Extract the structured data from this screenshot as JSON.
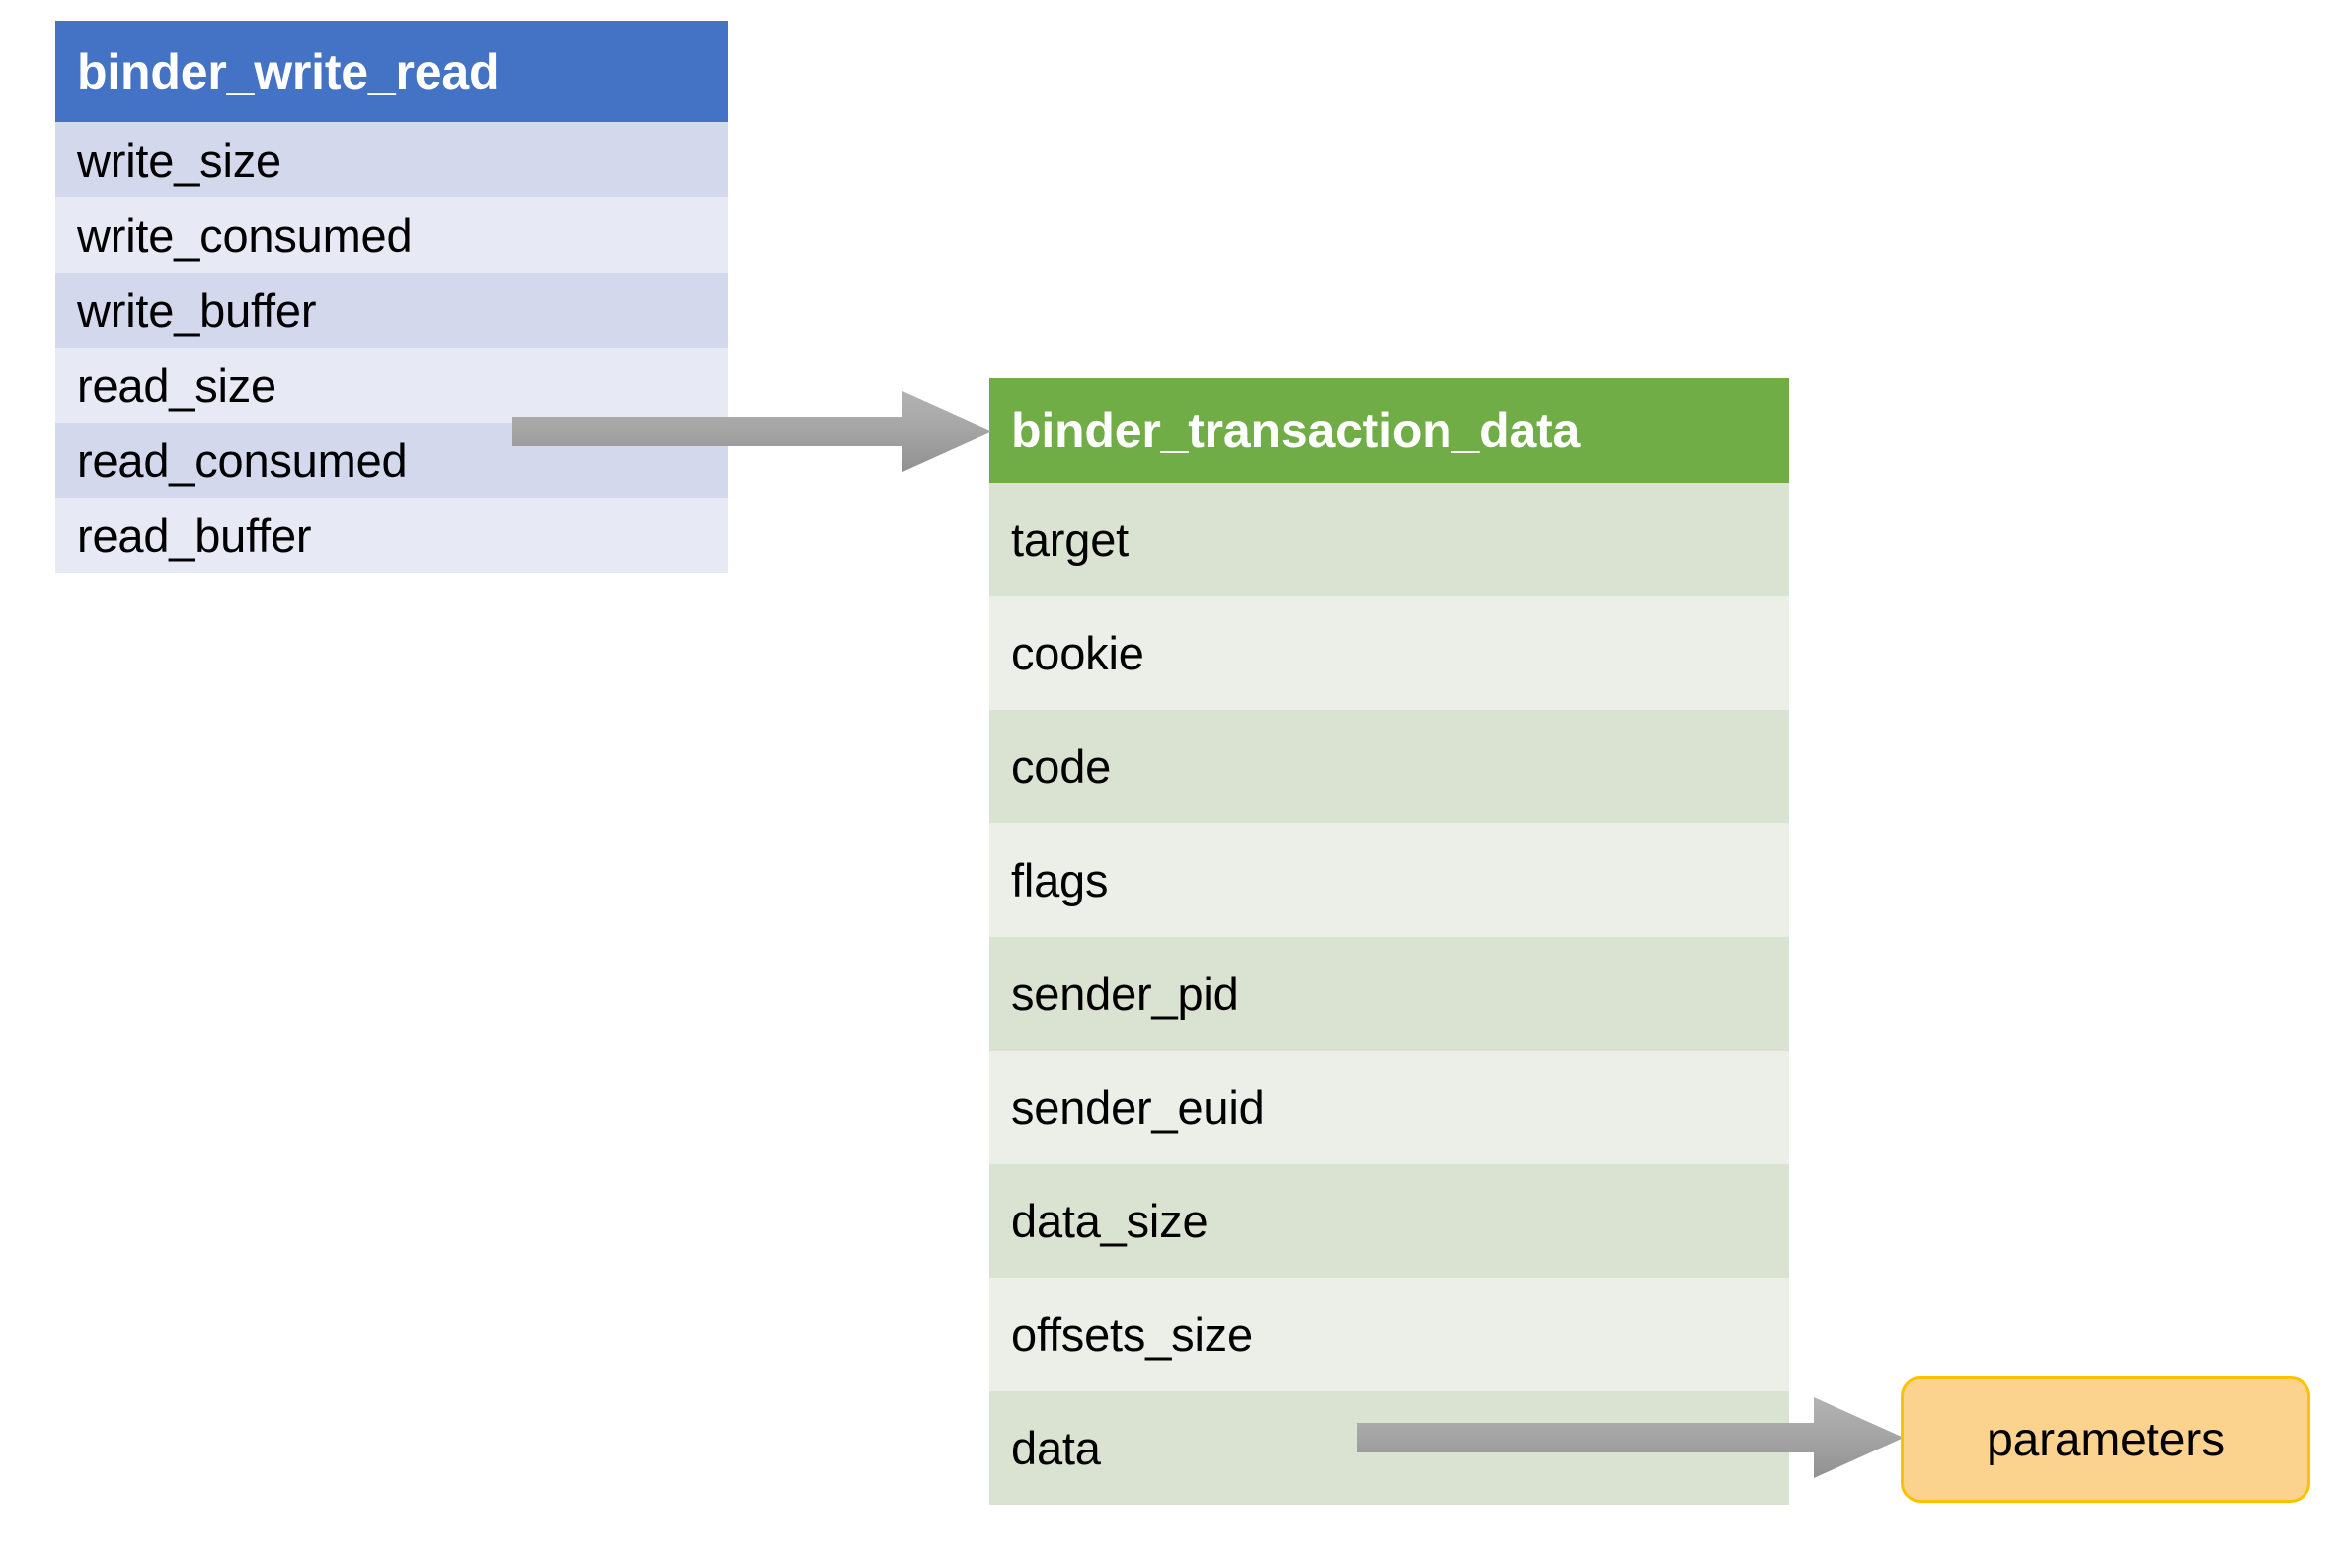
{
  "diagram": {
    "title_struct_left": "binder_write_read",
    "title_struct_right": "binder_transaction_data",
    "colors": {
      "left_header": "#4472C4",
      "left_row_odd": "#D3D8EC",
      "left_row_even": "#E7EAF5",
      "right_header": "#70AD47",
      "right_row_odd": "#DAE3D1",
      "right_row_even": "#EBEFE8",
      "node_fill": "#FBD28E",
      "node_border": "#FFC000",
      "arrow": "#A6A6A6"
    }
  },
  "binder_write_read": {
    "header": "binder_write_read",
    "fields": [
      {
        "name": "write_size"
      },
      {
        "name": "write_consumed"
      },
      {
        "name": "write_buffer"
      },
      {
        "name": "read_size"
      },
      {
        "name": "read_consumed"
      },
      {
        "name": "read_buffer"
      }
    ]
  },
  "binder_transaction_data": {
    "header": "binder_transaction_data",
    "fields": [
      {
        "name": "target"
      },
      {
        "name": "cookie"
      },
      {
        "name": "code"
      },
      {
        "name": "flags"
      },
      {
        "name": "sender_pid"
      },
      {
        "name": "sender_euid"
      },
      {
        "name": "data_size"
      },
      {
        "name": "offsets_size"
      },
      {
        "name": "data"
      }
    ]
  },
  "parameters_node": {
    "label": "parameters"
  },
  "connections": [
    {
      "from": "write_buffer",
      "to": "binder_transaction_data"
    },
    {
      "from": "data",
      "to": "parameters"
    }
  ]
}
